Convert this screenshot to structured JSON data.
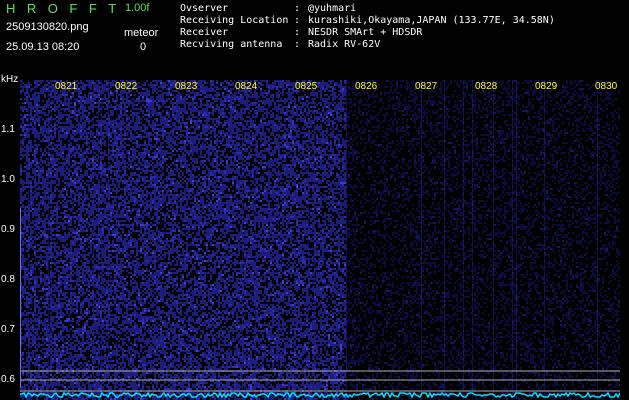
{
  "header": {
    "app_title": "HROFFT",
    "version": "1.00f",
    "filename": "2509130820.png",
    "timestamp": "25.09.13 08:20",
    "meteor_label": "meteor",
    "meteor_count": "0"
  },
  "station_info": [
    {
      "key": "Ovserver",
      "sep": ":",
      "value": "@yuhmari"
    },
    {
      "key": "Receiving Location",
      "sep": ":",
      "value": "kurashiki,Okayama,JAPAN (133.77E, 34.58N)"
    },
    {
      "key": "Receiver",
      "sep": ":",
      "value": "NESDR SMArt + HDSDR"
    },
    {
      "key": "Recviving antenna",
      "sep": ":",
      "value": "Radix RV-62V"
    }
  ],
  "waterfall": {
    "unit_label": "kHz",
    "time_labels": [
      "0821",
      "0822",
      "0823",
      "0824",
      "0825",
      "0826",
      "0827",
      "0828",
      "0829",
      "0830"
    ],
    "freq_labels": [
      "1.1",
      "1.0",
      "0.9",
      "0.8",
      "0.7",
      "0.6"
    ],
    "colors": {
      "background": "#000000",
      "noise_dense": "#1c1c7a",
      "noise_sparse": "#0c0c3a",
      "time_label": "#ffff00",
      "freq_label": "#ffffff",
      "signal_trace": "#00e5ff",
      "reference_line": "#aaaaaa"
    }
  }
}
